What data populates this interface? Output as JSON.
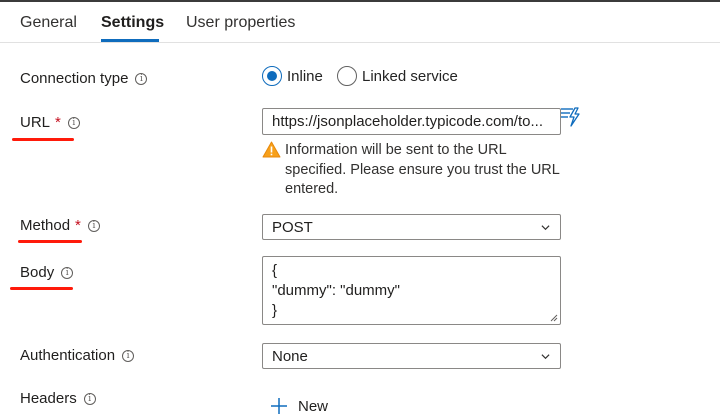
{
  "tabs": [
    {
      "label": "General"
    },
    {
      "label": "Settings"
    },
    {
      "label": "User properties"
    }
  ],
  "active_tab": "Settings",
  "form": {
    "connection_type": {
      "label": "Connection type",
      "options": [
        "Inline",
        "Linked service"
      ],
      "selected": "Inline"
    },
    "url": {
      "label": "URL",
      "required_mark": "*",
      "value": "https://jsonplaceholder.typicode.com/to..."
    },
    "warning": {
      "text": "Information will be sent to the URL specified. Please ensure you trust the URL entered."
    },
    "method": {
      "label": "Method",
      "required_mark": "*",
      "value": "POST"
    },
    "body": {
      "label": "Body",
      "lines": [
        "{",
        "\"dummy\": \"dummy\"",
        "}"
      ]
    },
    "authentication": {
      "label": "Authentication",
      "value": "None"
    },
    "headers": {
      "label": "Headers",
      "new_label": "New"
    }
  },
  "icons": {
    "info": "info-icon",
    "dynamic_content": "lightning-list-icon",
    "warning": "warning-triangle-icon",
    "chevron": "chevron-down-icon",
    "add": "plus-icon"
  },
  "colors": {
    "accent": "#0f6cbd",
    "required": "#c50f1f",
    "annotation": "#ff1a0a",
    "warning": "#f7a01a"
  }
}
